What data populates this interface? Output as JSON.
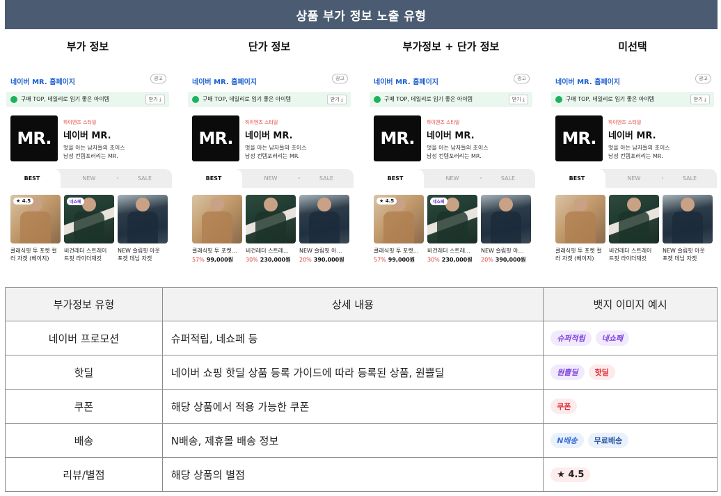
{
  "banner_title": "상품 부가 정보 노출 유형",
  "columns": [
    {
      "title": "부가 정보",
      "show_badges": true,
      "show_prices": false
    },
    {
      "title": "단가 정보",
      "show_badges": false,
      "show_prices": true
    },
    {
      "title": "부가정보 + 단가 정보",
      "show_badges": true,
      "show_prices": true
    },
    {
      "title": "미선택",
      "show_badges": false,
      "show_prices": false
    }
  ],
  "card": {
    "brand_link": "네이버 MR. 홈페이지",
    "ad_label": "광고",
    "promo_text": "구매 TOP, 데일리로 입기 좋은 아이템",
    "get_button": "받기 ⤓",
    "logo_text": "MR.",
    "style_label": "하이엔즈 스타일",
    "store_name": "네이버 MR.",
    "desc_line1": "멋을 아는 남자들의 초이스",
    "desc_line2": "남성 컨템포러리는 MR.",
    "tabs": [
      "BEST",
      "NEW",
      "SALE"
    ],
    "products": [
      {
        "name_full": "클래식핏 투 포켓 컬러 자켓 (베이지)",
        "name_short": "클래식핏 투 포켓…",
        "discount": "57%",
        "price": "99,000원",
        "badge": "★ 4.5"
      },
      {
        "name_full": "비건레더 스트레이 트핏 라이더재킷",
        "name_short": "비건레더 스트레…",
        "discount": "30%",
        "price": "230,000원",
        "badge": "네쇼페"
      },
      {
        "name_full": "NEW 슬림핏 아웃 포켓 데님 자켓",
        "name_short": "NEW 슬림핏 아…",
        "discount": "20%",
        "price": "390,000원",
        "badge": ""
      }
    ]
  },
  "table": {
    "headers": [
      "부가정보 유형",
      "상세 내용",
      "뱃지 이미지 예시"
    ],
    "rows": [
      {
        "type": "네이버 프로모션",
        "detail": "슈퍼적립, 네쇼페 등",
        "badges": [
          {
            "text": "슈퍼적립",
            "style": "purple"
          },
          {
            "text": "네쇼페",
            "style": "purple"
          }
        ]
      },
      {
        "type": "핫딜",
        "detail": "네이버 쇼핑 핫딜 상품 등록 가이드에 따라 등록된 상품, 원쁠딜",
        "badges": [
          {
            "text": "원쁠딜",
            "style": "purple"
          },
          {
            "text": "핫딜",
            "style": "red"
          }
        ]
      },
      {
        "type": "쿠폰",
        "detail": "해당 상품에서 적용 가능한 쿠폰",
        "badges": [
          {
            "text": "쿠폰",
            "style": "red"
          }
        ]
      },
      {
        "type": "배송",
        "detail": "N배송, 제휴몰 배송 정보",
        "badges": [
          {
            "text": "N배송",
            "style": "blue"
          },
          {
            "text": "무료배송",
            "style": "blue2"
          }
        ]
      },
      {
        "type": "리뷰/별점",
        "detail": "해당 상품의 별점",
        "badges": [
          {
            "text": "★ 4.5",
            "style": "rate"
          }
        ]
      }
    ]
  }
}
